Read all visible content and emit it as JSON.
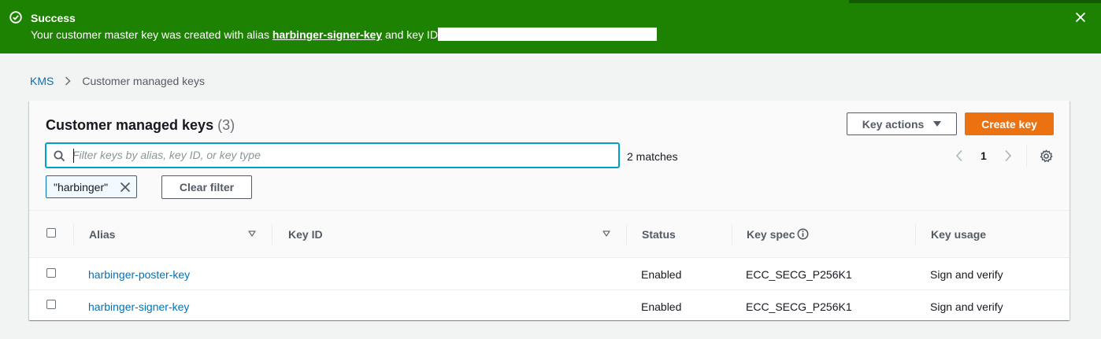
{
  "flash": {
    "title": "Success",
    "message_prefix": "Your customer master key was created with alias ",
    "alias": "harbinger-signer-key",
    "message_suffix": " and key ID",
    "color": "#1d8102"
  },
  "breadcrumb": {
    "items": [
      "KMS",
      "Customer managed keys"
    ]
  },
  "panel": {
    "title": "Customer managed keys",
    "count": "(3)",
    "key_actions_label": "Key actions",
    "create_key_label": "Create key",
    "search_placeholder": "Filter keys by alias, key ID, or key type",
    "matches": "2 matches",
    "page": "1",
    "filter_token": "\"harbinger\"",
    "clear_filter_label": "Clear filter"
  },
  "table": {
    "columns": [
      "Alias",
      "Key ID",
      "Status",
      "Key spec",
      "Key usage"
    ],
    "rows": [
      {
        "alias": "harbinger-poster-key",
        "key_id": "",
        "status": "Enabled",
        "key_spec": "ECC_SECG_P256K1",
        "key_usage": "Sign and verify"
      },
      {
        "alias": "harbinger-signer-key",
        "key_id": "",
        "status": "Enabled",
        "key_spec": "ECC_SECG_P256K1",
        "key_usage": "Sign and verify"
      }
    ]
  },
  "icons": [
    "success-check-icon",
    "close-icon",
    "chevron-right-icon",
    "search-icon",
    "caret-down-icon",
    "chevron-left-icon",
    "settings-gear-icon",
    "remove-token-icon",
    "sort-icon",
    "info-icon"
  ],
  "colors": {
    "accent": "#0073bb",
    "primary_button": "#ec7211",
    "success": "#1d8102"
  }
}
